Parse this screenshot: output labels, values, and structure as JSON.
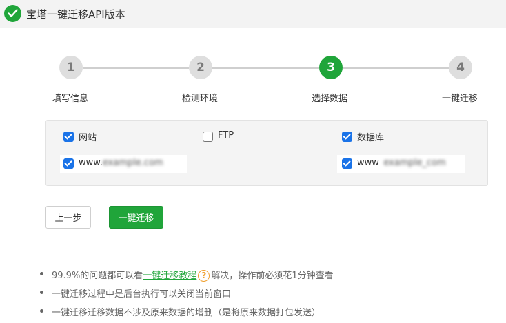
{
  "header": {
    "title": "宝塔一键迁移API版本",
    "icon": "check-circle-icon"
  },
  "steps": [
    {
      "number": "1",
      "label": "填写信息",
      "active": false
    },
    {
      "number": "2",
      "label": "检测环境",
      "active": false
    },
    {
      "number": "3",
      "label": "选择数据",
      "active": true
    },
    {
      "number": "4",
      "label": "一键迁移",
      "active": false
    }
  ],
  "options": {
    "website": {
      "label": "网站",
      "checked": true
    },
    "ftp": {
      "label": "FTP",
      "checked": false
    },
    "database": {
      "label": "数据库",
      "checked": true
    }
  },
  "sites": {
    "website_item": {
      "prefix": "www.",
      "blurred": "example.com",
      "checked": true
    },
    "database_item": {
      "prefix": "www_",
      "blurred": "example_com",
      "checked": true
    }
  },
  "buttons": {
    "prev": "上一步",
    "migrate": "一键迁移"
  },
  "notes": {
    "note1_pre": "99.9%的问题都可以看",
    "note1_link": "一键迁移教程",
    "note1_help": "?",
    "note1_post": "解决，操作前必须花1分钟查看",
    "note2": "一键迁移过程中是后台执行可以关闭当前窗口",
    "note3": "一键迁移迁移数据不涉及原来数据的增删（是将原来数据打包发送）"
  },
  "colors": {
    "accent": "#20a53a",
    "checkbox": "#1a73e8",
    "help": "#f0a030"
  }
}
